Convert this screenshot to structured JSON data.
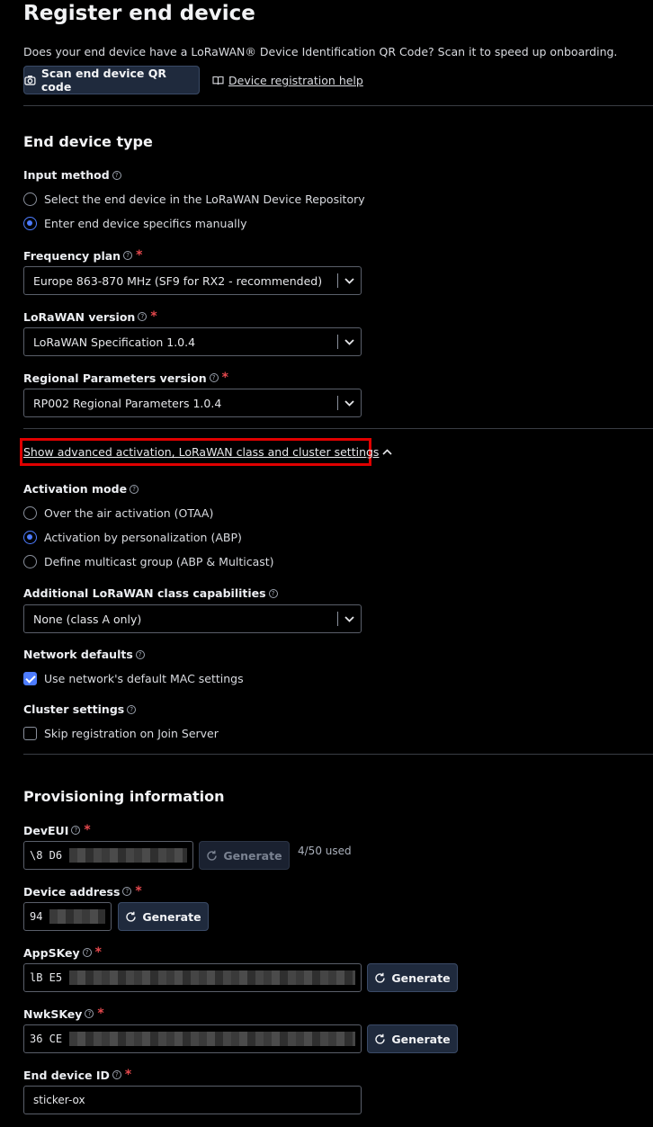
{
  "page": {
    "title": "Register end device"
  },
  "intro": {
    "text": "Does your end device have a LoRaWAN® Device Identification QR Code? Scan it to speed up onboarding.",
    "scan_button": "Scan end device QR code",
    "help_link": "Device registration help"
  },
  "device_type": {
    "heading": "End device type",
    "input_method": {
      "label": "Input method",
      "options": [
        "Select the end device in the LoRaWAN Device Repository",
        "Enter end device specifics manually"
      ],
      "selected_index": 1
    },
    "frequency_plan": {
      "label": "Frequency plan",
      "value": "Europe 863-870 MHz (SF9 for RX2 - recommended)"
    },
    "lorawan_version": {
      "label": "LoRaWAN version",
      "value": "LoRaWAN Specification 1.0.4"
    },
    "regional_parameters": {
      "label": "Regional Parameters version",
      "value": "RP002 Regional Parameters 1.0.4"
    }
  },
  "advanced": {
    "toggle_label": "Show advanced activation, LoRaWAN class and cluster settings",
    "activation_mode": {
      "label": "Activation mode",
      "options": [
        "Over the air activation (OTAA)",
        "Activation by personalization (ABP)",
        "Define multicast group (ABP & Multicast)"
      ],
      "selected_index": 1
    },
    "class_capabilities": {
      "label": "Additional LoRaWAN class capabilities",
      "value": "None (class A only)"
    },
    "network_defaults": {
      "label": "Network defaults",
      "checkbox_label": "Use network's default MAC settings",
      "checked": true
    },
    "cluster_settings": {
      "label": "Cluster settings",
      "checkbox_label": "Skip registration on Join Server",
      "checked": false
    }
  },
  "provisioning": {
    "heading": "Provisioning information",
    "dev_eui": {
      "label": "DevEUI",
      "value_prefix": "\\8 D6",
      "generate_label": "Generate",
      "usage": "4/50 used"
    },
    "device_address": {
      "label": "Device address",
      "value_prefix": "94",
      "generate_label": "Generate"
    },
    "app_skey": {
      "label": "AppSKey",
      "value_prefix": "lB E5",
      "generate_label": "Generate"
    },
    "nwk_skey": {
      "label": "NwkSKey",
      "value_prefix": "36 CE",
      "generate_label": "Generate"
    },
    "end_device_id": {
      "label": "End device ID",
      "value": "sticker-ox"
    }
  },
  "icons": {
    "help": "?",
    "colors": {
      "accent": "#4d7cff",
      "required": "#e5484d",
      "highlight": "#e00000"
    }
  }
}
